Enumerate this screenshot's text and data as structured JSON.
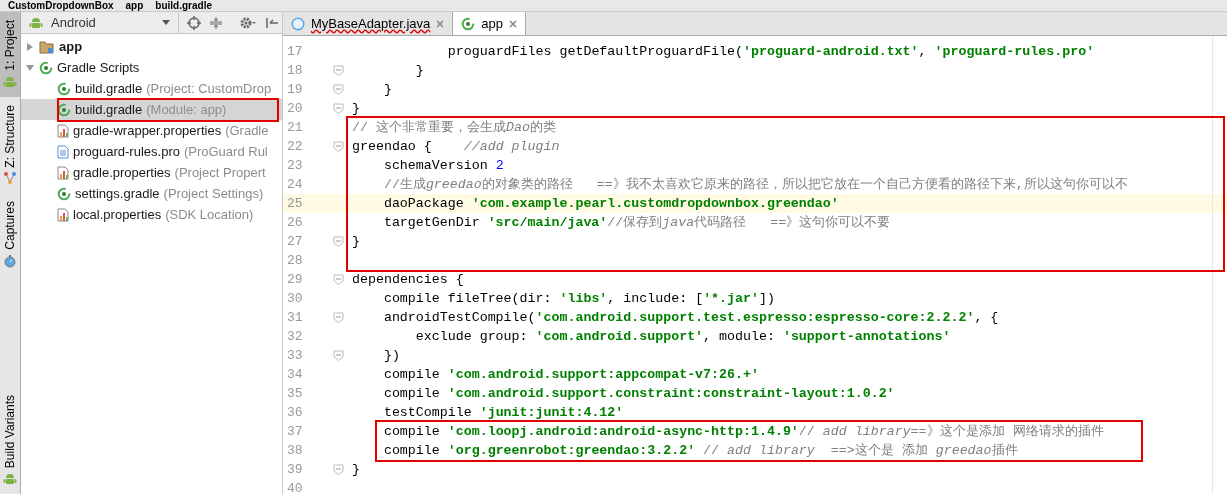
{
  "breadcrumb": [
    "CustomDropdownBox",
    "app",
    "build.gradle"
  ],
  "tool_strip": [
    {
      "label": "1: Project",
      "selected": true,
      "kind": "android"
    },
    {
      "label": "Z: Structure",
      "selected": false,
      "kind": "structure"
    },
    {
      "label": "Captures",
      "selected": false,
      "kind": "capture"
    },
    {
      "label": "Build Variants",
      "selected": false,
      "kind": "android"
    }
  ],
  "project_panel": {
    "view": "Android",
    "tree": [
      {
        "name": "app",
        "kind": "folder",
        "expanded": false,
        "marked": false,
        "selected": false
      },
      {
        "name": "Gradle Scripts",
        "kind": "gradle",
        "expanded": true,
        "marked": false,
        "selected": false,
        "children": [
          {
            "name": "build.gradle",
            "detail": "(Project: CustomDrop",
            "kind": "gradle",
            "marked": false,
            "selected": false
          },
          {
            "name": "build.gradle",
            "detail": "(Module: app)",
            "kind": "gradle",
            "marked": true,
            "selected": true
          },
          {
            "name": "gradle-wrapper.properties",
            "detail": "(Gradle",
            "kind": "properties",
            "marked": false,
            "selected": false
          },
          {
            "name": "proguard-rules.pro",
            "detail": "(ProGuard Rul",
            "kind": "text",
            "marked": false,
            "selected": false
          },
          {
            "name": "gradle.properties",
            "detail": "(Project Propert",
            "kind": "properties",
            "marked": false,
            "selected": false
          },
          {
            "name": "settings.gradle",
            "detail": "(Project Settings)",
            "kind": "gradle",
            "marked": false,
            "selected": false
          },
          {
            "name": "local.properties",
            "detail": "(SDK Location)",
            "kind": "properties",
            "marked": false,
            "selected": false
          }
        ]
      }
    ]
  },
  "editor_tabs": [
    {
      "label": "MyBaseAdapter.java",
      "kind": "class",
      "selected": false,
      "error": true
    },
    {
      "label": "app",
      "kind": "gradle",
      "selected": true,
      "error": false
    }
  ],
  "lines": [
    {
      "n": "17",
      "fold": false,
      "current": false,
      "framed": false,
      "tokens": [
        {
          "t": "            proguardFiles getDefaultProguardFile(",
          "kind": "plain"
        },
        {
          "t": "'proguard-android.txt'",
          "kind": "string"
        },
        {
          "t": ", ",
          "kind": "plain"
        },
        {
          "t": "'proguard-rules.pro'",
          "kind": "string"
        }
      ]
    },
    {
      "n": "18",
      "fold": true,
      "current": false,
      "framed": false,
      "tokens": [
        {
          "t": "        }",
          "kind": "plain"
        }
      ]
    },
    {
      "n": "19",
      "fold": true,
      "current": false,
      "framed": false,
      "tokens": [
        {
          "t": "    }",
          "kind": "plain"
        }
      ]
    },
    {
      "n": "20",
      "fold": true,
      "current": false,
      "framed": false,
      "tokens": [
        {
          "t": "}",
          "kind": "plain"
        }
      ]
    },
    {
      "n": "21",
      "fold": false,
      "current": false,
      "framed": true,
      "tokens": [
        {
          "t": "// 这个非常重要，会生成",
          "kind": "comment"
        },
        {
          "t": "Dao",
          "kind": "comment-italic"
        },
        {
          "t": "的类",
          "kind": "comment"
        }
      ]
    },
    {
      "n": "22",
      "fold": true,
      "current": false,
      "framed": true,
      "tokens": [
        {
          "t": "greendao {    ",
          "kind": "plain"
        },
        {
          "t": "//add plugin",
          "kind": "comment-italic"
        }
      ]
    },
    {
      "n": "23",
      "fold": false,
      "current": false,
      "framed": true,
      "tokens": [
        {
          "t": "    schemaVersion ",
          "kind": "plain"
        },
        {
          "t": "2",
          "kind": "number"
        }
      ]
    },
    {
      "n": "24",
      "fold": false,
      "current": false,
      "framed": true,
      "tokens": [
        {
          "t": "    //生成",
          "kind": "comment"
        },
        {
          "t": "greedao",
          "kind": "comment-italic"
        },
        {
          "t": "的对象类的路径   ==》我不太喜欢它原来的路径，所以把它放在一个自己方便看的路径下来,所以这句你可以不",
          "kind": "comment"
        }
      ]
    },
    {
      "n": "25",
      "fold": false,
      "current": true,
      "framed": true,
      "tokens": [
        {
          "t": "    daoPackage ",
          "kind": "plain"
        },
        {
          "t": "'com.example.pearl.customdropdownbox.greendao'",
          "kind": "string"
        }
      ]
    },
    {
      "n": "26",
      "fold": false,
      "current": false,
      "framed": true,
      "tokens": [
        {
          "t": "    targetGenDir ",
          "kind": "plain"
        },
        {
          "t": "'src/main/java'",
          "kind": "string"
        },
        {
          "t": "//保存到",
          "kind": "comment"
        },
        {
          "t": "java",
          "kind": "comment-italic"
        },
        {
          "t": "代码路径   ==》这句你可以不要",
          "kind": "comment"
        }
      ]
    },
    {
      "n": "27",
      "fold": true,
      "current": false,
      "framed": true,
      "tokens": [
        {
          "t": "}",
          "kind": "plain"
        }
      ]
    },
    {
      "n": "28",
      "fold": false,
      "current": false,
      "framed": true
    },
    {
      "n": "29",
      "fold": true,
      "current": false,
      "framed": false,
      "tokens": [
        {
          "t": "dependencies {",
          "kind": "plain"
        }
      ]
    },
    {
      "n": "30",
      "fold": false,
      "current": false,
      "framed": false,
      "tokens": [
        {
          "t": "    compile fileTree(dir: ",
          "kind": "plain"
        },
        {
          "t": "'libs'",
          "kind": "string"
        },
        {
          "t": ", include: [",
          "kind": "plain"
        },
        {
          "t": "'*.jar'",
          "kind": "string"
        },
        {
          "t": "])",
          "kind": "plain"
        }
      ]
    },
    {
      "n": "31",
      "fold": true,
      "current": false,
      "framed": false,
      "tokens": [
        {
          "t": "    androidTestCompile(",
          "kind": "plain"
        },
        {
          "t": "'com.android.support.test.espresso:espresso-core:2.2.2'",
          "kind": "string"
        },
        {
          "t": ", {",
          "kind": "plain"
        }
      ]
    },
    {
      "n": "32",
      "fold": false,
      "current": false,
      "framed": false,
      "tokens": [
        {
          "t": "        exclude group: ",
          "kind": "plain"
        },
        {
          "t": "'com.android.support'",
          "kind": "string"
        },
        {
          "t": ", module: ",
          "kind": "plain"
        },
        {
          "t": "'support-annotations'",
          "kind": "string"
        }
      ]
    },
    {
      "n": "33",
      "fold": true,
      "current": false,
      "framed": false,
      "tokens": [
        {
          "t": "    })",
          "kind": "plain"
        }
      ]
    },
    {
      "n": "34",
      "fold": false,
      "current": false,
      "framed": false,
      "tokens": [
        {
          "t": "    compile ",
          "kind": "plain"
        },
        {
          "t": "'com.android.support:appcompat-v7:26.+'",
          "kind": "string"
        }
      ]
    },
    {
      "n": "35",
      "fold": false,
      "current": false,
      "framed": false,
      "tokens": [
        {
          "t": "    compile ",
          "kind": "plain"
        },
        {
          "t": "'com.android.support.constraint:constraint-layout:1.0.2'",
          "kind": "string"
        }
      ]
    },
    {
      "n": "36",
      "fold": false,
      "current": false,
      "framed": false,
      "tokens": [
        {
          "t": "    testCompile ",
          "kind": "plain"
        },
        {
          "t": "'junit:junit:4.12'",
          "kind": "string"
        }
      ]
    },
    {
      "n": "37",
      "fold": false,
      "current": false,
      "framed": true,
      "tokens": [
        {
          "t": "    compile ",
          "kind": "plain"
        },
        {
          "t": "'com.loopj.android:android-async-http:1.4.9'",
          "kind": "string"
        },
        {
          "t": "// ",
          "kind": "comment"
        },
        {
          "t": "add library",
          "kind": "comment-italic"
        },
        {
          "t": "==》这个是添加 网络请求的插件",
          "kind": "comment"
        }
      ]
    },
    {
      "n": "38",
      "fold": false,
      "current": false,
      "framed": true,
      "tokens": [
        {
          "t": "    compile ",
          "kind": "plain"
        },
        {
          "t": "'org.greenrobot:greendao:3.2.2'",
          "kind": "string"
        },
        {
          "t": " // ",
          "kind": "comment"
        },
        {
          "t": "add library  ==>",
          "kind": "comment-italic"
        },
        {
          "t": "这个是 添加 ",
          "kind": "comment"
        },
        {
          "t": "greedao",
          "kind": "comment-italic"
        },
        {
          "t": "插件",
          "kind": "comment"
        }
      ]
    },
    {
      "n": "39",
      "fold": true,
      "current": false,
      "framed": false,
      "tokens": [
        {
          "t": "}",
          "kind": "plain"
        }
      ]
    },
    {
      "n": "40",
      "fold": false,
      "current": false,
      "framed": false
    }
  ]
}
